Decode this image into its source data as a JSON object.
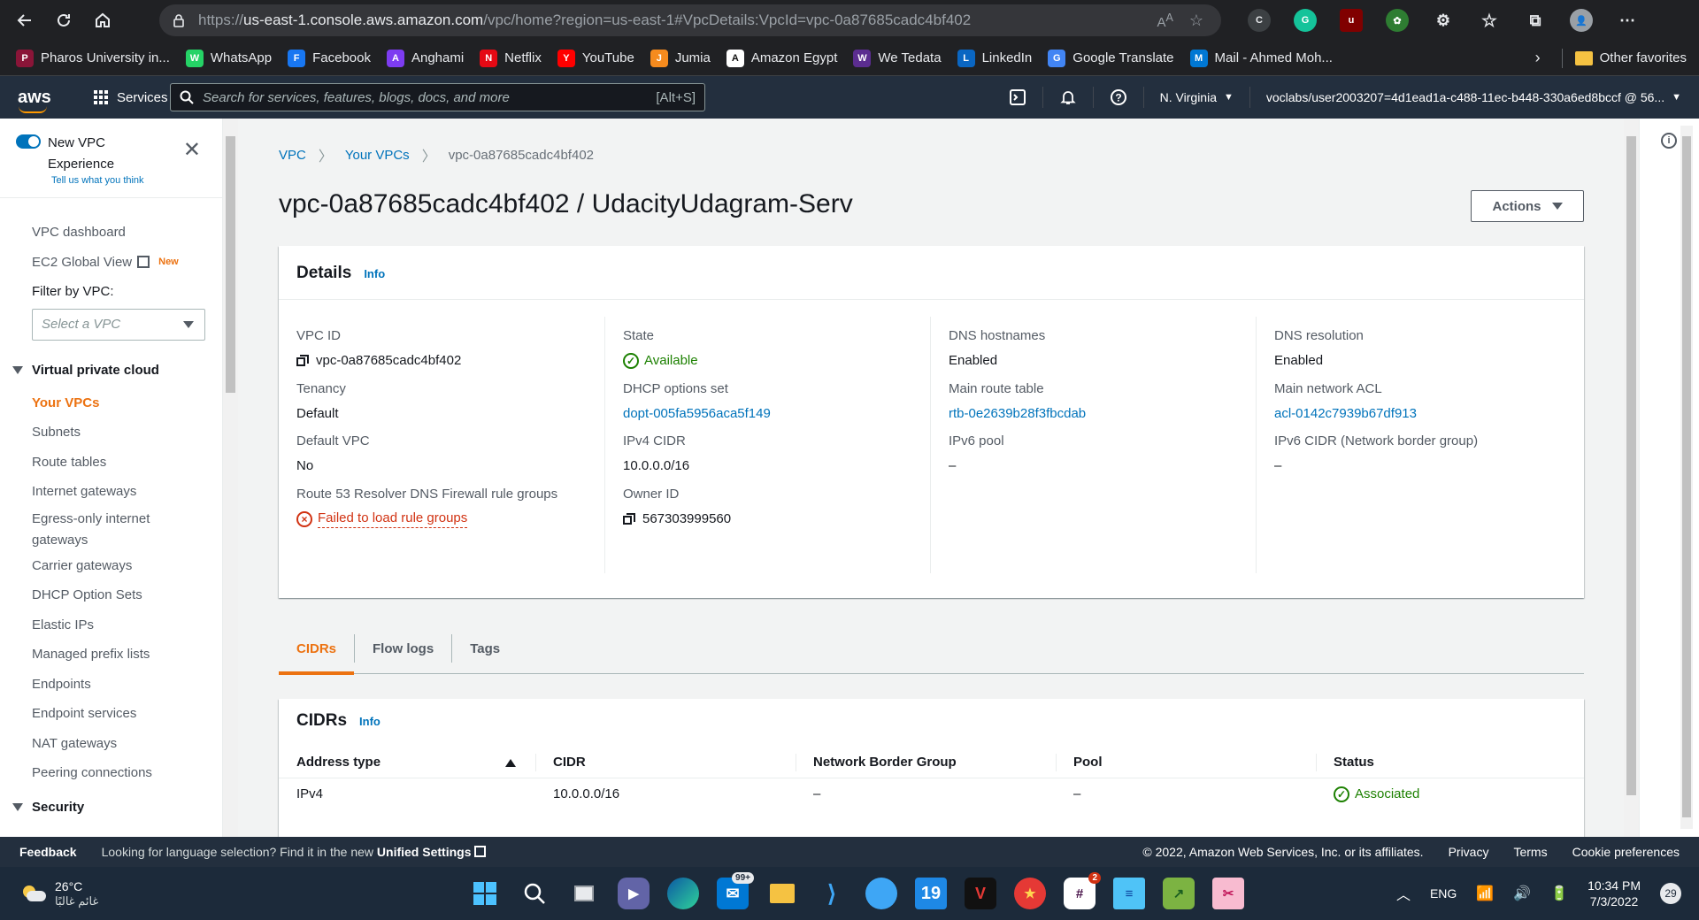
{
  "browser": {
    "url_prefix": "https://",
    "url_host": "us-east-1.console.aws.amazon.com",
    "url_path": "/vpc/home?region=us-east-1#VpcDetails:VpcId=vpc-0a87685cadc4bf402",
    "bookmarks": [
      {
        "label": "Pharos University in...",
        "icon": "pharos-icon",
        "color": "#8a1538"
      },
      {
        "label": "WhatsApp",
        "icon": "whatsapp-icon",
        "color": "#25d366"
      },
      {
        "label": "Facebook",
        "icon": "facebook-icon",
        "color": "#1877f2"
      },
      {
        "label": "Anghami",
        "icon": "anghami-icon",
        "color": "#7d3cf1"
      },
      {
        "label": "Netflix",
        "icon": "netflix-icon",
        "color": "#e50914"
      },
      {
        "label": "YouTube",
        "icon": "youtube-icon",
        "color": "#ff0000"
      },
      {
        "label": "Jumia",
        "icon": "jumia-icon",
        "color": "#f68b1e"
      },
      {
        "label": "Amazon Egypt",
        "icon": "amazon-icon",
        "color": "#ffffff"
      },
      {
        "label": "We Tedata",
        "icon": "we-icon",
        "color": "#5b2d90"
      },
      {
        "label": "LinkedIn",
        "icon": "linkedin-icon",
        "color": "#0a66c2"
      },
      {
        "label": "Google Translate",
        "icon": "google-translate-icon",
        "color": "#4285f4"
      },
      {
        "label": "Mail - Ahmed Moh...",
        "icon": "outlook-icon",
        "color": "#0078d4"
      }
    ],
    "other_favorites": "Other favorites"
  },
  "aws_top": {
    "logo": "aws",
    "services": "Services",
    "search_placeholder": "Search for services, features, blogs, docs, and more",
    "search_shortcut": "[Alt+S]",
    "region": "N. Virginia",
    "account": "voclabs/user2003207=4d1ead1a-c488-11ec-b448-330a6ed8bccf @ 56..."
  },
  "sidebar": {
    "new_vpc_title": "New VPC Experience",
    "new_vpc_feedback": "Tell us what you think",
    "dashboard": "VPC dashboard",
    "ec2_global_view": "EC2 Global View",
    "new_badge": "New",
    "filter_label": "Filter by VPC:",
    "select_placeholder": "Select a VPC",
    "section_vpc": "Virtual private cloud",
    "items": [
      "Your VPCs",
      "Subnets",
      "Route tables",
      "Internet gateways",
      "Egress-only internet gateways",
      "Carrier gateways",
      "DHCP Option Sets",
      "Elastic IPs",
      "Managed prefix lists",
      "Endpoints",
      "Endpoint services",
      "NAT gateways",
      "Peering connections"
    ],
    "section_security": "Security"
  },
  "breadcrumb": {
    "root": "VPC",
    "parent": "Your VPCs",
    "current": "vpc-0a87685cadc4bf402"
  },
  "page": {
    "title": "vpc-0a87685cadc4bf402 / UdacityUdagram-Serv",
    "actions": "Actions"
  },
  "details": {
    "header": "Details",
    "info": "Info",
    "col1": [
      {
        "k": "VPC ID",
        "v": "vpc-0a87685cadc4bf402"
      },
      {
        "k": "Tenancy",
        "v": "Default"
      },
      {
        "k": "Default VPC",
        "v": "No"
      },
      {
        "k": "Route 53 Resolver DNS Firewall rule groups",
        "v": "Failed to load rule groups"
      }
    ],
    "col2": [
      {
        "k": "State",
        "v": "Available"
      },
      {
        "k": "DHCP options set",
        "v": "dopt-005fa5956aca5f149"
      },
      {
        "k": "IPv4 CIDR",
        "v": "10.0.0.0/16"
      },
      {
        "k": "Owner ID",
        "v": "567303999560"
      }
    ],
    "col3": [
      {
        "k": "DNS hostnames",
        "v": "Enabled"
      },
      {
        "k": "Main route table",
        "v": "rtb-0e2639b28f3fbcdab"
      },
      {
        "k": "IPv6 pool",
        "v": "–"
      }
    ],
    "col4": [
      {
        "k": "DNS resolution",
        "v": "Enabled"
      },
      {
        "k": "Main network ACL",
        "v": "acl-0142c7939b67df913"
      },
      {
        "k": "IPv6 CIDR (Network border group)",
        "v": "–"
      }
    ]
  },
  "tabs": [
    "CIDRs",
    "Flow logs",
    "Tags"
  ],
  "cidrs": {
    "header": "CIDRs",
    "info": "Info",
    "columns": [
      "Address type",
      "CIDR",
      "Network Border Group",
      "Pool",
      "Status"
    ],
    "rows": [
      {
        "address_type": "IPv4",
        "cidr": "10.0.0.0/16",
        "nbg": "–",
        "pool": "–",
        "status": "Associated"
      }
    ]
  },
  "footer": {
    "feedback": "Feedback",
    "lang_prompt": "Looking for language selection? Find it in the new",
    "unified_settings": "Unified Settings",
    "copyright": "© 2022, Amazon Web Services, Inc. or its affiliates.",
    "privacy": "Privacy",
    "terms": "Terms",
    "cookies": "Cookie preferences"
  },
  "taskbar": {
    "temp": "26°C",
    "condition": "غائم غالبًا",
    "mail_badge": "99+",
    "slack_badge": "2",
    "app19": "19",
    "lang": "ENG",
    "time": "10:34 PM",
    "date": "7/3/2022",
    "notifications": "29"
  },
  "colors": {
    "aws_nav": "#232f3e",
    "accent_orange": "#ec7211",
    "link_blue": "#0073bb",
    "success_green": "#1d8102",
    "error_red": "#d13212"
  }
}
